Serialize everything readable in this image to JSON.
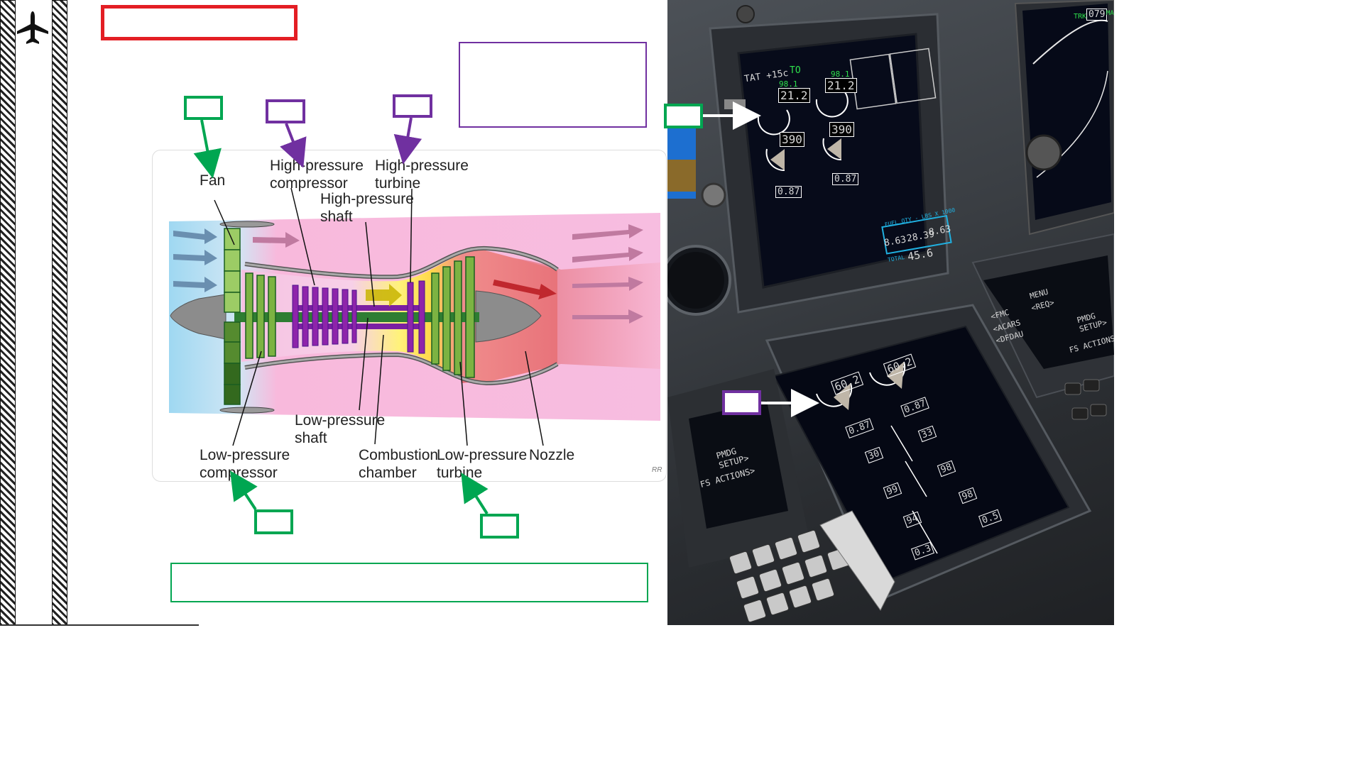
{
  "sidebar": {
    "icon": "airplane-icon"
  },
  "diagram": {
    "labels": {
      "fan": "Fan",
      "hp_compressor": "High-pressure\ncompressor",
      "hp_turbine": "High-pressure\nturbine",
      "hp_shaft": "High-pressure\nshaft",
      "lp_shaft": "Low-pressure\nshaft",
      "lp_compressor": "Low-pressure\ncompressor",
      "combustion": "Combustion\nchamber",
      "lp_turbine": "Low-pressure\nturbine",
      "nozzle": "Nozzle"
    },
    "signature": "RR"
  },
  "cockpit": {
    "upper": {
      "tat": "TAT +15c",
      "mode": "TO",
      "n1_ref_left": "98.1",
      "n1_ref_right": "98.1",
      "n1_left": "21.2",
      "n1_right": "21.2",
      "egt_left": "390",
      "egt_right": "390",
      "ff_left": "0.87",
      "ff_right": "0.87",
      "fuel_title": "FUEL QTY - LBS X 1000",
      "fuel_left": "8.63",
      "fuel_center": "28.39",
      "fuel_right": "8.63",
      "fuel_total": "45.6",
      "total_label": "TOTAL"
    },
    "lower": {
      "n2_left": "60.2",
      "n2_right": "60.2",
      "ff_left": "0.87",
      "ff_right": "0.87",
      "oil_press_left": "30",
      "oil_press_right": "33",
      "oil_temp_left": "99",
      "oil_temp_right": "98",
      "oil_qty_left": "94",
      "oil_qty_right": "98",
      "vib_left": "0.3",
      "vib_right": "0.5"
    },
    "cdu": {
      "menu": "MENU",
      "req": "<REQ>",
      "fmc": "<FMC",
      "acars": "<ACARS",
      "dfdau": "<DFDAU",
      "pmdg_setup": "PMDG\nSETUP>",
      "fs_actions": "FS ACTIONS>",
      "pmdg_setup_left": "PMDG\nSETUP>",
      "fs_actions_left": "FS ACTIONS>"
    },
    "nd": {
      "track": "TRK",
      "heading": "079",
      "mag": "MAG"
    },
    "colors": {
      "green": "#00a651",
      "purple": "#7030a0",
      "red": "#e31e24"
    }
  }
}
